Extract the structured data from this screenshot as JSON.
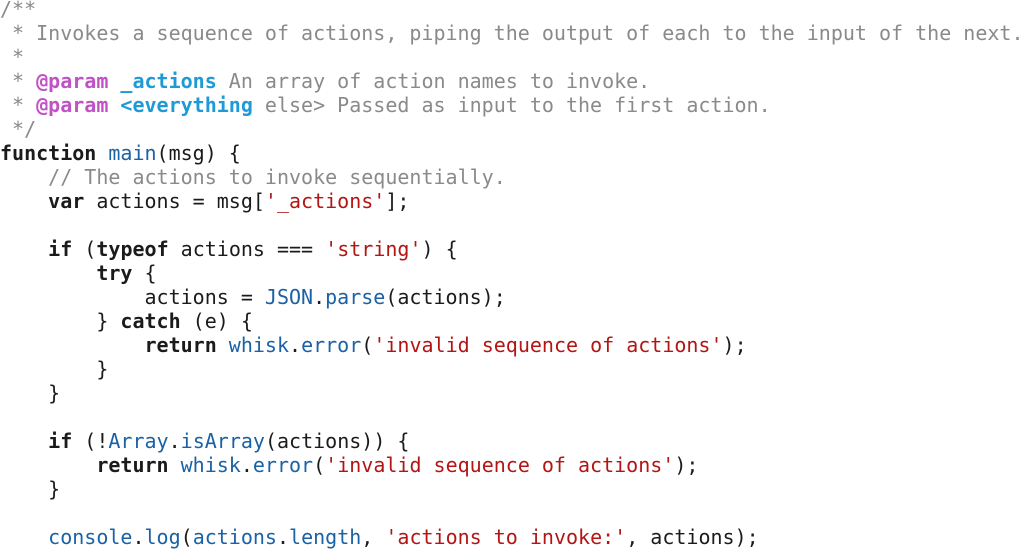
{
  "colors": {
    "background": "#ffffff",
    "text": "#1b1b1b",
    "comment": "#8a8a8a",
    "doc_tag": "#c052c6",
    "doc_param": "#1e9bd7",
    "string": "#b31515",
    "function": "#1a61a6"
  },
  "code": {
    "lines": [
      [
        {
          "t": "comment",
          "v": "/**"
        }
      ],
      [
        {
          "t": "comment",
          "v": " * Invokes a sequence of actions, piping the output of each to the input of the next."
        }
      ],
      [
        {
          "t": "comment",
          "v": " *"
        }
      ],
      [
        {
          "t": "comment",
          "v": " * "
        },
        {
          "t": "doctag",
          "v": "@param"
        },
        {
          "t": "comment",
          "v": " "
        },
        {
          "t": "docparam",
          "v": "_actions"
        },
        {
          "t": "comment",
          "v": " An array of action names to invoke."
        }
      ],
      [
        {
          "t": "comment",
          "v": " * "
        },
        {
          "t": "doctag",
          "v": "@param"
        },
        {
          "t": "comment",
          "v": " "
        },
        {
          "t": "docparam",
          "v": "<everything"
        },
        {
          "t": "comment",
          "v": " else> Passed as input to the first action."
        }
      ],
      [
        {
          "t": "comment",
          "v": " */"
        }
      ],
      [
        {
          "t": "keyword",
          "v": "function"
        },
        {
          "t": "plain",
          "v": " "
        },
        {
          "t": "fn",
          "v": "main"
        },
        {
          "t": "plain",
          "v": "(msg) {"
        }
      ],
      [
        {
          "t": "plain",
          "v": "    "
        },
        {
          "t": "comment",
          "v": "// The actions to invoke sequentially."
        }
      ],
      [
        {
          "t": "plain",
          "v": "    "
        },
        {
          "t": "keyword",
          "v": "var"
        },
        {
          "t": "plain",
          "v": " actions = msg["
        },
        {
          "t": "string",
          "v": "'_actions'"
        },
        {
          "t": "plain",
          "v": "];"
        }
      ],
      [
        {
          "t": "plain",
          "v": ""
        }
      ],
      [
        {
          "t": "plain",
          "v": "    "
        },
        {
          "t": "keyword",
          "v": "if"
        },
        {
          "t": "plain",
          "v": " ("
        },
        {
          "t": "keyword",
          "v": "typeof"
        },
        {
          "t": "plain",
          "v": " actions === "
        },
        {
          "t": "string",
          "v": "'string'"
        },
        {
          "t": "plain",
          "v": ") {"
        }
      ],
      [
        {
          "t": "plain",
          "v": "        "
        },
        {
          "t": "keyword",
          "v": "try"
        },
        {
          "t": "plain",
          "v": " {"
        }
      ],
      [
        {
          "t": "plain",
          "v": "            actions = "
        },
        {
          "t": "builtin",
          "v": "JSON"
        },
        {
          "t": "plain",
          "v": "."
        },
        {
          "t": "fn",
          "v": "parse"
        },
        {
          "t": "plain",
          "v": "(actions);"
        }
      ],
      [
        {
          "t": "plain",
          "v": "        } "
        },
        {
          "t": "keyword",
          "v": "catch"
        },
        {
          "t": "plain",
          "v": " (e) {"
        }
      ],
      [
        {
          "t": "plain",
          "v": "            "
        },
        {
          "t": "keyword",
          "v": "return"
        },
        {
          "t": "plain",
          "v": " "
        },
        {
          "t": "builtin",
          "v": "whisk"
        },
        {
          "t": "plain",
          "v": "."
        },
        {
          "t": "fn",
          "v": "error"
        },
        {
          "t": "plain",
          "v": "("
        },
        {
          "t": "string",
          "v": "'invalid sequence of actions'"
        },
        {
          "t": "plain",
          "v": ");"
        }
      ],
      [
        {
          "t": "plain",
          "v": "        }"
        }
      ],
      [
        {
          "t": "plain",
          "v": "    }"
        }
      ],
      [
        {
          "t": "plain",
          "v": ""
        }
      ],
      [
        {
          "t": "plain",
          "v": "    "
        },
        {
          "t": "keyword",
          "v": "if"
        },
        {
          "t": "plain",
          "v": " (!"
        },
        {
          "t": "builtin",
          "v": "Array"
        },
        {
          "t": "plain",
          "v": "."
        },
        {
          "t": "fn",
          "v": "isArray"
        },
        {
          "t": "plain",
          "v": "(actions)) {"
        }
      ],
      [
        {
          "t": "plain",
          "v": "        "
        },
        {
          "t": "keyword",
          "v": "return"
        },
        {
          "t": "plain",
          "v": " "
        },
        {
          "t": "builtin",
          "v": "whisk"
        },
        {
          "t": "plain",
          "v": "."
        },
        {
          "t": "fn",
          "v": "error"
        },
        {
          "t": "plain",
          "v": "("
        },
        {
          "t": "string",
          "v": "'invalid sequence of actions'"
        },
        {
          "t": "plain",
          "v": ");"
        }
      ],
      [
        {
          "t": "plain",
          "v": "    }"
        }
      ],
      [
        {
          "t": "plain",
          "v": ""
        }
      ],
      [
        {
          "t": "plain",
          "v": "    "
        },
        {
          "t": "builtin",
          "v": "console"
        },
        {
          "t": "plain",
          "v": "."
        },
        {
          "t": "fn",
          "v": "log"
        },
        {
          "t": "plain",
          "v": "("
        },
        {
          "t": "builtin",
          "v": "actions"
        },
        {
          "t": "plain",
          "v": "."
        },
        {
          "t": "builtin",
          "v": "length"
        },
        {
          "t": "plain",
          "v": ", "
        },
        {
          "t": "string",
          "v": "'actions to invoke:'"
        },
        {
          "t": "plain",
          "v": ", actions);"
        }
      ]
    ]
  }
}
